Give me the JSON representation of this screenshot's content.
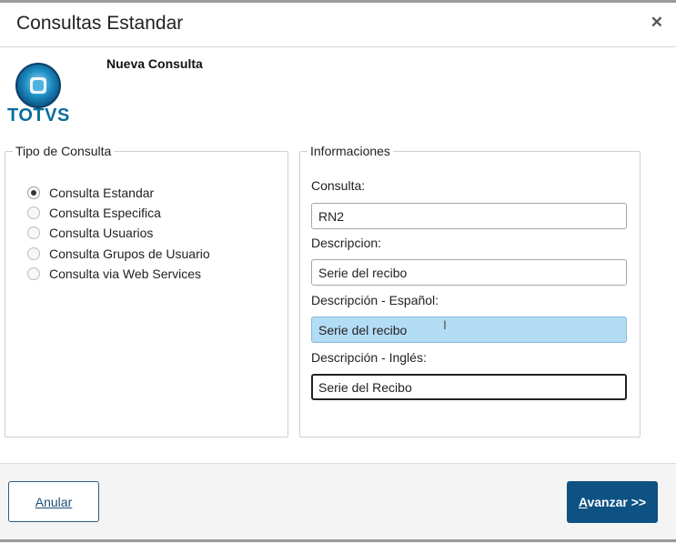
{
  "window": {
    "title": "Consultas Estandar",
    "close_icon": "close-icon"
  },
  "header": {
    "logo_text": "TOTVS",
    "subtitle": "Nueva Consulta"
  },
  "tipo": {
    "legend": "Tipo de Consulta",
    "selected": "Consulta Estandar",
    "options": [
      "Consulta Estandar",
      "Consulta Especifica",
      "Consulta Usuarios",
      "Consulta Grupos de Usuario",
      "Consulta via Web Services"
    ]
  },
  "info": {
    "legend": "Informaciones",
    "consulta_label": "Consulta:",
    "consulta_value": "RN2",
    "descripcion_label": "Descripcion:",
    "descripcion_value": "Serie del recibo",
    "desc_es_label": "Descripción - Español:",
    "desc_es_value": "Serie del recibo",
    "desc_en_label": "Descripción - Inglés:",
    "desc_en_value": "Serie del Recibo"
  },
  "footer": {
    "cancel_label": "Anular",
    "next_first": "A",
    "next_rest": "vanzar >>"
  },
  "colors": {
    "primary": "#0d5283",
    "highlight": "#b3dcf5",
    "logo": "#0b6d9c"
  }
}
